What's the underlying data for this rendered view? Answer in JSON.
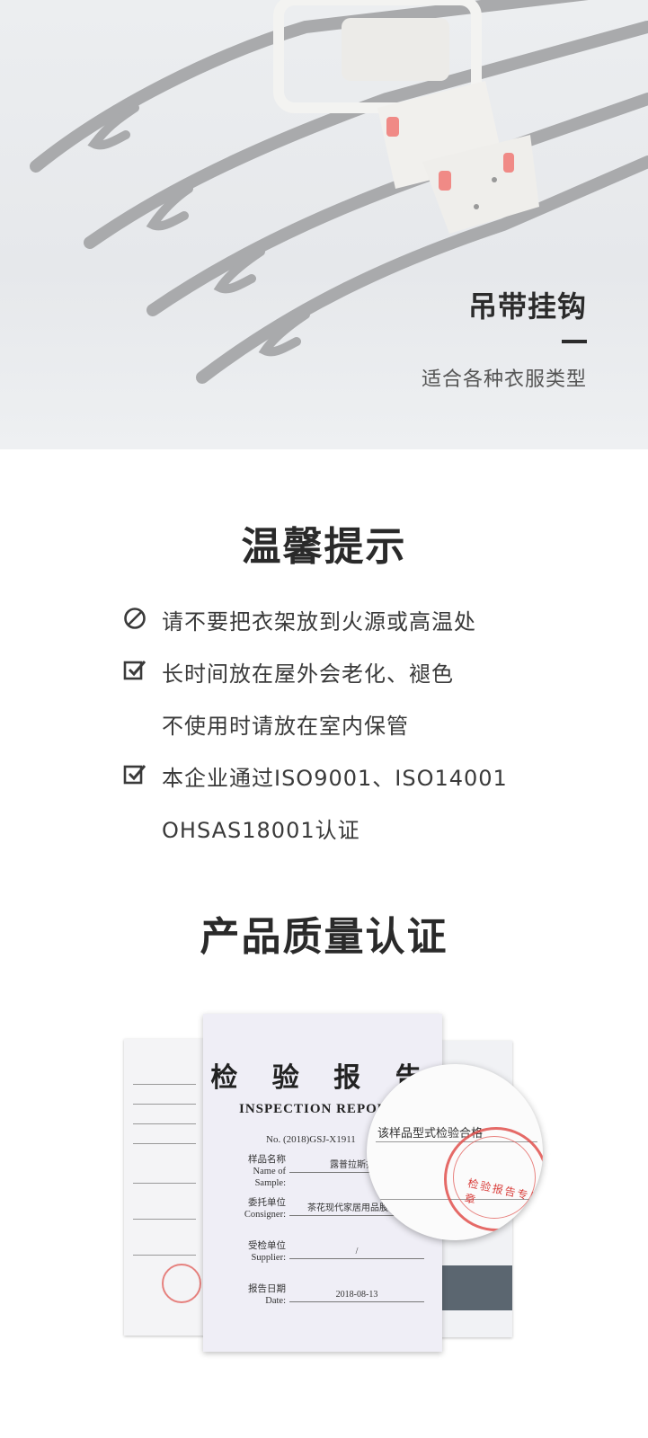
{
  "hero": {
    "title": "吊带挂钩",
    "subtitle": "适合各种衣服类型"
  },
  "tips": {
    "heading": "温馨提示",
    "items": [
      {
        "icon": "prohibited-icon",
        "line1": "请不要把衣架放到火源或高温处",
        "line2": ""
      },
      {
        "icon": "checkbox-icon",
        "line1": "长时间放在屋外会老化、褪色",
        "line2": "不使用时请放在室内保管"
      },
      {
        "icon": "checkbox-icon",
        "line1": "本企业通过ISO9001、ISO14001",
        "line2": "OHSAS18001认证"
      }
    ]
  },
  "quality": {
    "heading": "产品质量认证",
    "report": {
      "title_cn": "检 验 报 告",
      "title_en": "INSPECTION REPORT",
      "number": "No. (2018)GSJ-X1911",
      "sample_label_cn": "样品名称",
      "sample_label_en": "Name of Sample:",
      "sample_value": "露普拉斯折叠",
      "consignor_label_cn": "委托单位",
      "consignor_label_en": "Consigner:",
      "consignor_value": "茶花现代家居用品股份有",
      "supplier_label_cn": "受检单位",
      "supplier_label_en": "Supplier:",
      "supplier_value": "/",
      "date_label_cn": "报告日期",
      "date_label_en": "Date:",
      "date_value": "2018-08-13"
    },
    "zoom_text": "该样品型式检验合格",
    "stamp_text": "检验报告专用章"
  }
}
